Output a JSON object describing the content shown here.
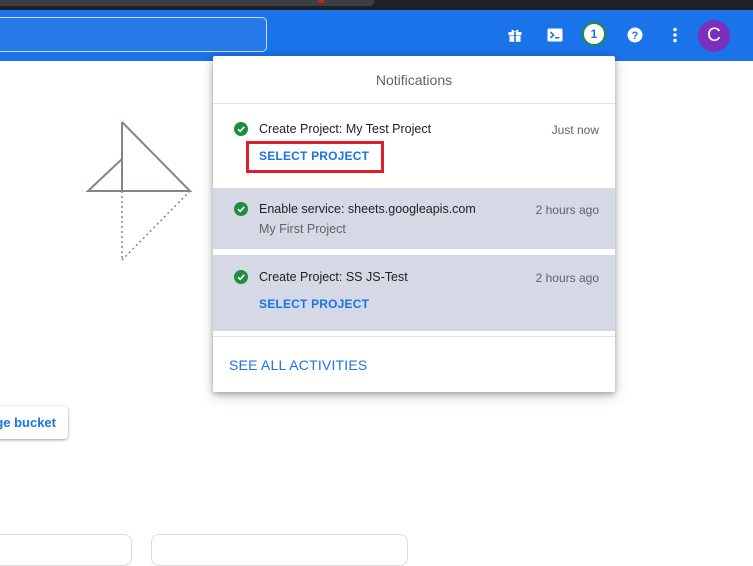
{
  "appbar": {
    "notification_count": "1",
    "avatar_letter": "C",
    "icons": [
      "gift-icon",
      "cloud-shell-icon",
      "help-icon",
      "more-vert-icon"
    ]
  },
  "main": {
    "bucket_button_label": "ge bucket"
  },
  "notifications": {
    "header": "Notifications",
    "items": [
      {
        "title": "Create Project: My Test Project",
        "time": "Just now",
        "action": "SELECT PROJECT",
        "status": "success"
      },
      {
        "title": "Enable service: sheets.googleapis.com",
        "time": "2 hours ago",
        "subtitle": "My First Project",
        "status": "success"
      },
      {
        "title": "Create Project: SS JS-Test",
        "time": "2 hours ago",
        "action": "SELECT PROJECT",
        "status": "success"
      }
    ],
    "footer_link": "SEE ALL ACTIVITIES"
  },
  "colors": {
    "appbar": "#1a73e8",
    "link": "#1a73e8",
    "success": "#1e8e3e",
    "avatar": "#7b2fbf",
    "highlight": "#e01e2b",
    "read_item_bg": "#d4d9e5"
  }
}
